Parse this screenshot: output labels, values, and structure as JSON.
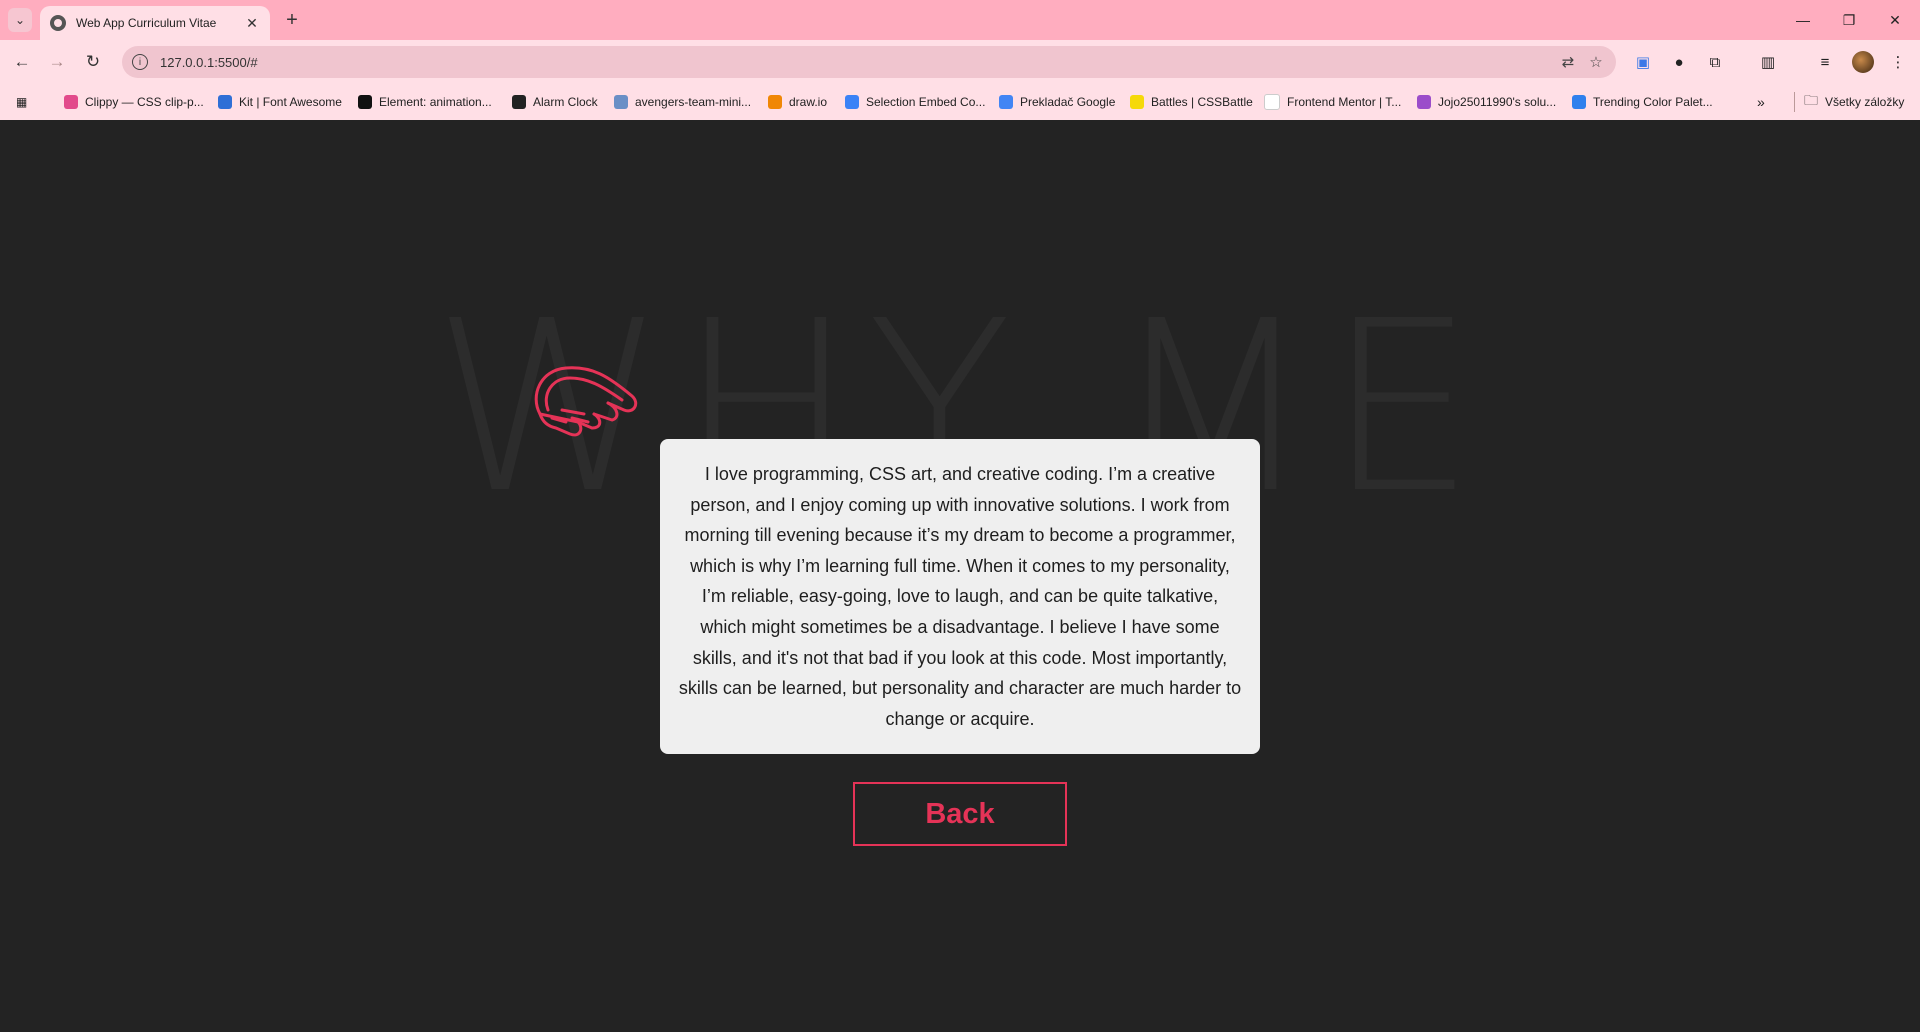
{
  "browser": {
    "tab_title": "Web App Curriculum Vitae",
    "url": "127.0.0.1:5500/#",
    "bookmarks": [
      {
        "label": "Clippy — CSS clip-p...",
        "color": "#e24a8b"
      },
      {
        "label": "Kit | Font Awesome",
        "color": "#2f6fd6"
      },
      {
        "label": "Element: animation...",
        "color": "#111111"
      },
      {
        "label": "Alarm Clock",
        "color": "#222222"
      },
      {
        "label": "avengers-team-mini...",
        "color": "#6a8fc6"
      },
      {
        "label": "draw.io",
        "color": "#f08705"
      },
      {
        "label": "Selection Embed Co...",
        "color": "#3b82f6"
      },
      {
        "label": "Prekladač Google",
        "color": "#4285f4"
      },
      {
        "label": "Battles | CSSBattle",
        "color": "#f5d90a"
      },
      {
        "label": "Frontend Mentor | T...",
        "color": "#ffffff"
      },
      {
        "label": "Jojo25011990's solu...",
        "color": "#9b4dca"
      },
      {
        "label": "Trending Color Palet...",
        "color": "#2f80ed"
      }
    ],
    "all_bookmarks_label": "Všetky záložky"
  },
  "page": {
    "background_title": "WHY ME",
    "description": "I love programming, CSS art, and creative coding. I’m a creative person, and I enjoy coming up with innovative solutions. I work from morning till evening because it’s my dream to become a programmer, which is why I’m learning full time. When it comes to my personality, I’m reliable, easy-going, love to laugh, and can be quite talkative, which might sometimes be a disadvantage. I believe I have some skills, and it's not that bad if you look at this code. Most importantly, skills can be learned, but personality and character are much harder to change or acquire.",
    "back_label": "Back",
    "accent_color": "#e53357",
    "hand_icon": "pointing-hand-icon"
  }
}
